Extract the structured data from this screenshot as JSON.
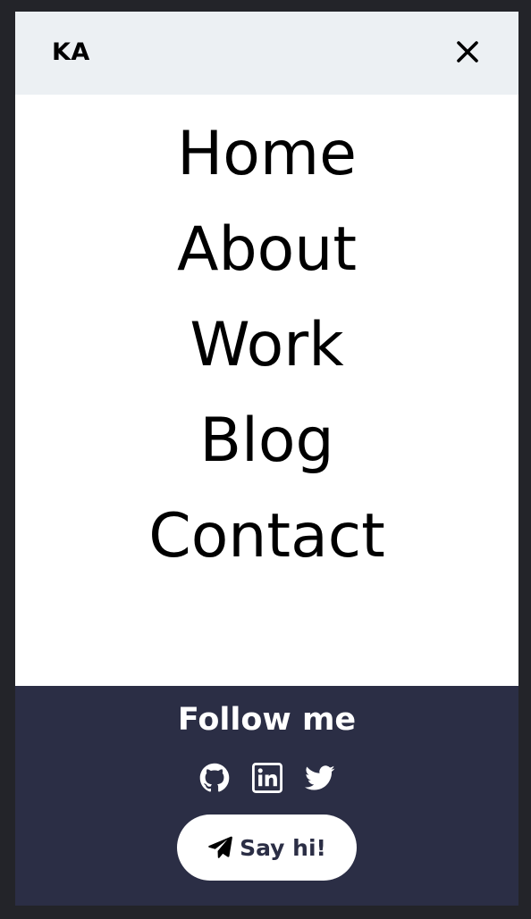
{
  "header": {
    "logo": "KA",
    "close_icon": "close-icon"
  },
  "nav": {
    "items": [
      "Home",
      "About",
      "Work",
      "Blog",
      "Contact"
    ]
  },
  "footer": {
    "heading": "Follow me",
    "socials": [
      "github-icon",
      "linkedin-icon",
      "twitter-icon"
    ],
    "cta_label": "Say hi!",
    "cta_icon": "paper-plane-icon"
  },
  "colors": {
    "page_bg": "#232429",
    "header_bg": "#ecf0f3",
    "footer_bg": "#2b2e45",
    "text_dark": "#000000",
    "text_light": "#ffffff"
  }
}
